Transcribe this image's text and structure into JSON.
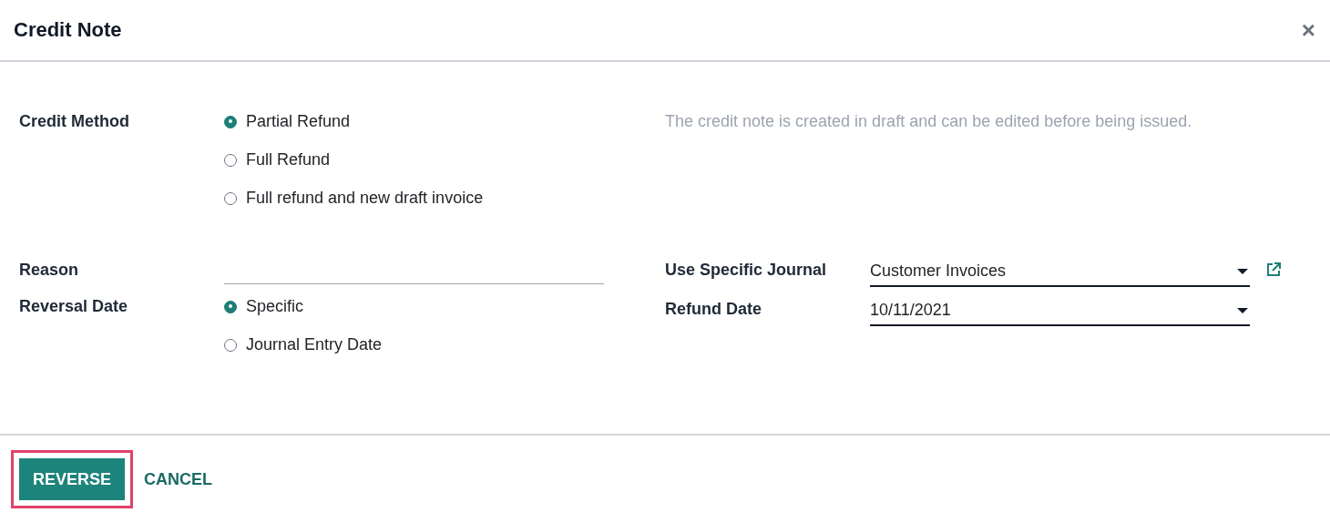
{
  "dialog": {
    "title": "Credit Note",
    "close": "×"
  },
  "credit_method": {
    "label": "Credit Method",
    "options": [
      {
        "label": "Partial Refund",
        "selected": true
      },
      {
        "label": "Full Refund",
        "selected": false
      },
      {
        "label": "Full refund and new draft invoice",
        "selected": false
      }
    ],
    "note": "The credit note is created in draft and can be edited before being issued."
  },
  "reason": {
    "label": "Reason"
  },
  "reversal_date": {
    "label": "Reversal Date",
    "options": [
      {
        "label": "Specific",
        "selected": true
      },
      {
        "label": "Journal Entry Date",
        "selected": false
      }
    ]
  },
  "journal": {
    "label": "Use Specific Journal",
    "value": "Customer Invoices"
  },
  "refund_date": {
    "label": "Refund Date",
    "value": "10/11/2021"
  },
  "buttons": [
    {
      "label": "REVERSE",
      "kind": "primary",
      "highlighted": true
    },
    {
      "label": "CANCEL",
      "kind": "link",
      "highlighted": false
    }
  ]
}
